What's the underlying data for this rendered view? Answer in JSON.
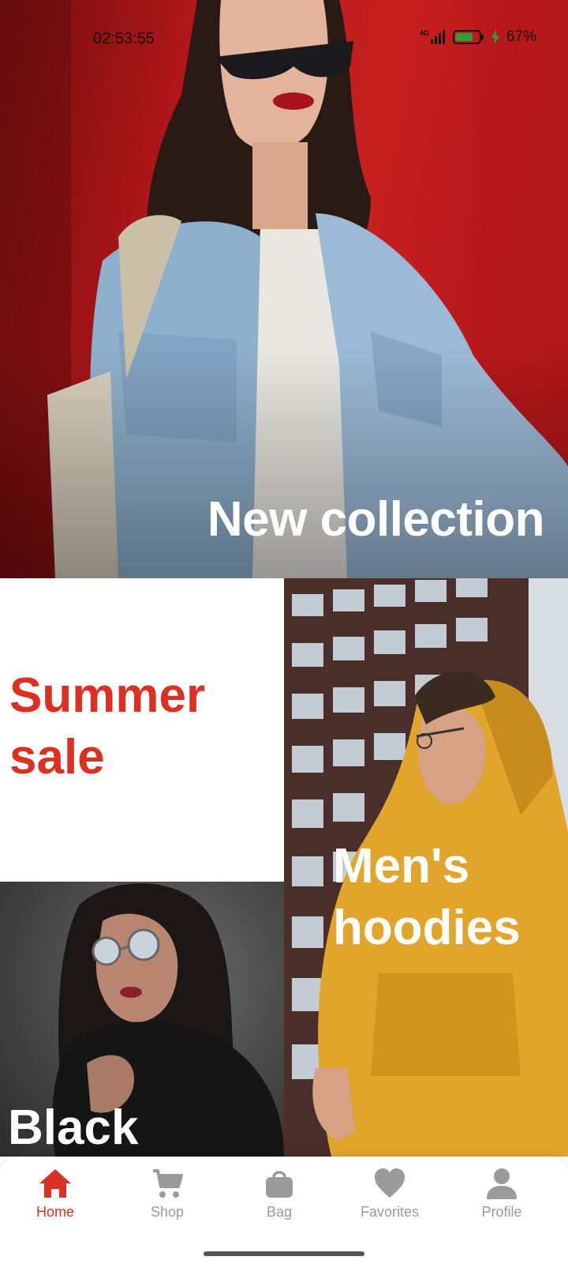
{
  "status_bar": {
    "time": "02:53:55",
    "battery_percent": "67%",
    "network": "4G",
    "battery_color": "#2e9e36"
  },
  "hero": {
    "title": "New collection"
  },
  "tiles": {
    "summer_sale": "Summer sale",
    "mens_hoodies": "Men's hoodies",
    "black": "Black"
  },
  "bottom_nav": {
    "active_color": "#db3022",
    "inactive_color": "#9b9b9b",
    "items": [
      {
        "label": "Home",
        "icon": "home-icon",
        "active": true
      },
      {
        "label": "Shop",
        "icon": "cart-icon",
        "active": false
      },
      {
        "label": "Bag",
        "icon": "bag-icon",
        "active": false
      },
      {
        "label": "Favorites",
        "icon": "heart-icon",
        "active": false
      },
      {
        "label": "Profile",
        "icon": "profile-icon",
        "active": false
      }
    ]
  }
}
